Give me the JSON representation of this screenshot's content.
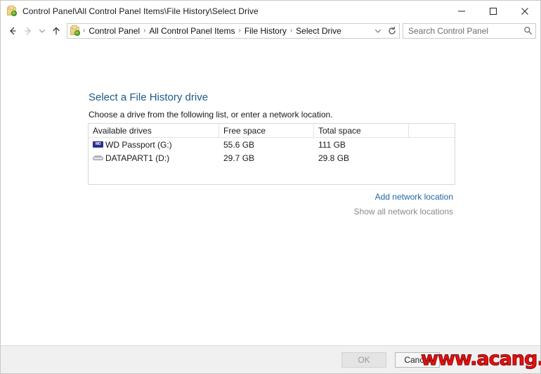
{
  "window": {
    "title": "Control Panel\\All Control Panel Items\\File History\\Select Drive",
    "title_icon": "control-panel-icon",
    "minimize_label": "—",
    "maximize_label": "□",
    "close_label": "✕"
  },
  "navbar": {
    "back_icon": "back-arrow-icon",
    "forward_icon": "forward-arrow-icon",
    "recent_icon": "chevron-down-icon",
    "up_icon": "up-arrow-icon",
    "address_icon": "control-panel-icon",
    "breadcrumbs": [
      {
        "label": "Control Panel"
      },
      {
        "label": "All Control Panel Items"
      },
      {
        "label": "File History"
      },
      {
        "label": "Select Drive"
      }
    ],
    "separator": "›",
    "dropdown_icon": "chevron-down-icon",
    "refresh_icon": "refresh-icon"
  },
  "search": {
    "placeholder": "Search Control Panel",
    "icon": "search-icon"
  },
  "main": {
    "title": "Select a File History drive",
    "subtitle": "Choose a drive from the following list, or enter a network location.",
    "columns": [
      "Available drives",
      "Free space",
      "Total space",
      ""
    ],
    "drives": [
      {
        "name": "WD Passport (G:)",
        "free_space": "55.6 GB",
        "total_space": "111 GB",
        "icon": "wd-drive-icon",
        "icon_label": "WD"
      },
      {
        "name": "DATAPART1 (D:)",
        "free_space": "29.7 GB",
        "total_space": "29.8 GB",
        "icon": "hard-drive-icon",
        "icon_label": ""
      }
    ],
    "add_network_location": "Add network location",
    "show_all_network_locations": "Show all network locations"
  },
  "footer": {
    "ok_label": "OK",
    "cancel_label": "Cancel"
  },
  "watermark": {
    "text": "www.acang.cn"
  },
  "colors": {
    "heading_blue": "#1d5a8a",
    "link_blue": "#1d68a7",
    "disabled_gray": "#8a8a8a",
    "watermark_red": "#ef0c0c",
    "wd_badge_blue": "#2a2f8f"
  }
}
